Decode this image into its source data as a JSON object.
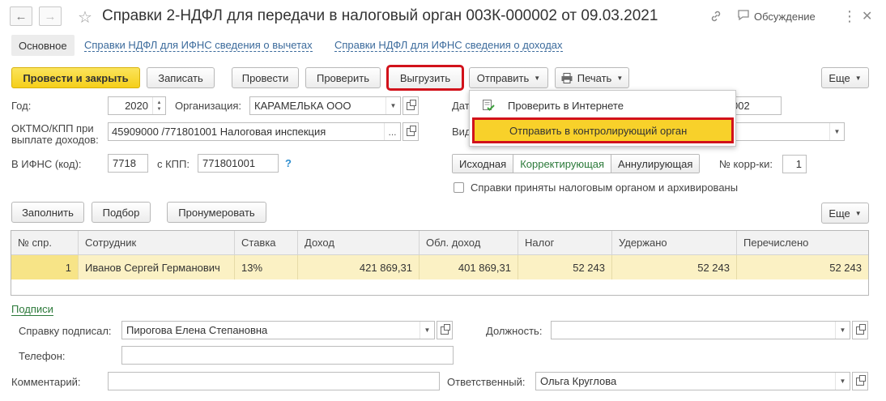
{
  "header": {
    "title": "Справки 2-НДФЛ для передачи в налоговый орган 003К-000002 от 09.03.2021",
    "back_glyph": "←",
    "forward_glyph": "→",
    "star_glyph": "☆",
    "discuss_label": "Обсуждение",
    "more_glyph": "⋮",
    "close_glyph": "✕",
    "icons": [
      "back-arrow-icon",
      "forward-arrow-icon",
      "star-icon",
      "link-icon",
      "comment-icon",
      "more-vertical-icon",
      "close-icon"
    ]
  },
  "tabs": {
    "main": "Основное",
    "link1": "Справки НДФЛ для ИФНС сведения о вычетах",
    "link2": "Справки НДФЛ для ИФНС сведения о доходах"
  },
  "toolbar": {
    "post_close": "Провести и закрыть",
    "save": "Записать",
    "post": "Провести",
    "check": "Проверить",
    "export": "Выгрузить",
    "send": "Отправить",
    "print": "Печать",
    "more": "Еще"
  },
  "send_menu": {
    "item1": "Проверить в Интернете",
    "item2": "Отправить в контролирующий орган"
  },
  "form": {
    "year_label": "Год:",
    "year_value": "2020",
    "org_label": "Организация:",
    "org_value": "КАРАМЕЛЬКА ООО",
    "oktmo_label_1": "ОКТМО/КПП при",
    "oktmo_label_2": "выплате доходов:",
    "oktmo_value": "45909000   /771801001 Налоговая инспекция",
    "ifns_label": "В ИФНС (код):",
    "ifns_value": "7718",
    "kpp_label": "с КПП:",
    "kpp_value": "771801001",
    "help_glyph": "?",
    "date_label": "Дат",
    "date_value": "002",
    "kind_label": "Вид",
    "seg_original": "Исходная",
    "seg_corrective": "Корректирующая",
    "seg_cancelling": "Аннулирующая",
    "corr_label": "№ корр-ки:",
    "corr_value": "1",
    "accepted_label": "Справки приняты налоговым органом и архивированы"
  },
  "table_toolbar": {
    "fill": "Заполнить",
    "pick": "Подбор",
    "renumber": "Пронумеровать",
    "more": "Еще"
  },
  "table": {
    "columns": [
      "№ спр.",
      "Сотрудник",
      "Ставка",
      "Доход",
      "Обл. доход",
      "Налог",
      "Удержано",
      "Перечислено"
    ],
    "rows": [
      [
        "1",
        "Иванов Сергей Германович",
        "13%",
        "421 869,31",
        "401 869,31",
        "52 243",
        "52 243",
        "52 243"
      ]
    ]
  },
  "signatures": {
    "section_link": "Подписи",
    "signed_label": "Справку подписал:",
    "signed_value": "Пирогова Елена Степановна",
    "position_label": "Должность:",
    "position_value": "",
    "phone_label": "Телефон:",
    "phone_value": "",
    "comment_label": "Комментарий:",
    "comment_value": "",
    "responsible_label": "Ответственный:",
    "responsible_value": "Ольга Круглова"
  },
  "colors": {
    "primary_button": "#f5cf1a",
    "highlight_frame": "#d2121b",
    "selected_row": "#fbf1c4",
    "link_blue": "#3c6b9c",
    "link_green": "#2c7a3a"
  }
}
